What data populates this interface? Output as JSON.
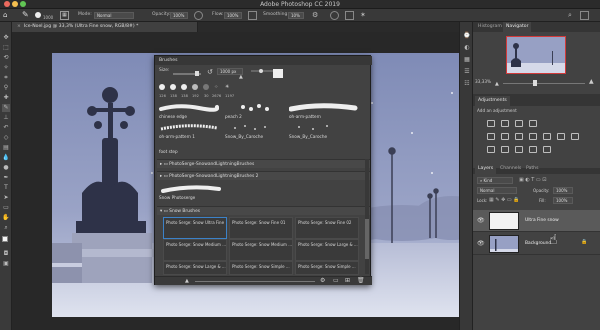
{
  "window": {
    "title": "Adobe Photoshop CC 2019"
  },
  "options_bar": {
    "size_value": "1000",
    "mode_label": "Mode:",
    "mode_value": "Normal",
    "opacity_label": "Opacity:",
    "opacity_value": "100%",
    "flow_label": "Flow:",
    "flow_value": "100%",
    "smoothing_label": "Smoothing:",
    "smoothing_value": "10%"
  },
  "document_tab": {
    "label": "Ice-Noel.jpg @ 33,3% (Ultra Fine snow, RGB/8#) *"
  },
  "brushes_panel": {
    "title": "Brushes",
    "size_label": "Size:",
    "size_value": "1000 px",
    "preset_sizes": [
      "126",
      "138",
      "138",
      "192",
      "30",
      "2676",
      "1197"
    ],
    "top_row_labels": [
      "chinese edge",
      "peach 2",
      "oh-arm-pattern"
    ],
    "second_row_labels": [
      "oh-arm-pattern 1",
      "Snow_By_Caroche",
      "Snow_By_Caroche"
    ],
    "footstep_label": "foot step",
    "groups": [
      "PhotoSerge-SnowandLightningBrushes",
      "PhotoSerge-SnowandLightningBrushes 2",
      "Snow Photoserge",
      "Snow Brushes"
    ],
    "snow_brushes": [
      "Photo Serge: Snow Ultra Fine",
      "Photo Serge: Snow Fine 01",
      "Photo Serge: Snow Fine 02",
      "Photo Serge: Snow Medium ...",
      "Photo Serge: Snow Medium ...",
      "Photo Serge: Snow Large & ...",
      "Photo Serge: Snow Large & ...",
      "Photo Serge: Snow Simple ...",
      "Photo Serge: Snow Simple ..."
    ]
  },
  "navigator": {
    "tabs": [
      "Histogram",
      "Navigator"
    ],
    "zoom": "33,33%"
  },
  "adjustments": {
    "tab": "Adjustments",
    "subtitle": "Add an adjustment"
  },
  "layers": {
    "tabs": [
      "Layers",
      "Channels",
      "Paths"
    ],
    "kind_label": "Kind",
    "blend_mode": "Normal",
    "opacity_label": "Opacity:",
    "opacity_value": "100%",
    "lock_label": "Lock:",
    "fill_label": "Fill:",
    "fill_value": "100%",
    "items": [
      {
        "name": "Ultra Fine snow"
      },
      {
        "name": "Background"
      }
    ]
  },
  "colors": {
    "accent": "#3c82c8",
    "panel": "#424242",
    "snow_sky": "#8e9ac0"
  }
}
